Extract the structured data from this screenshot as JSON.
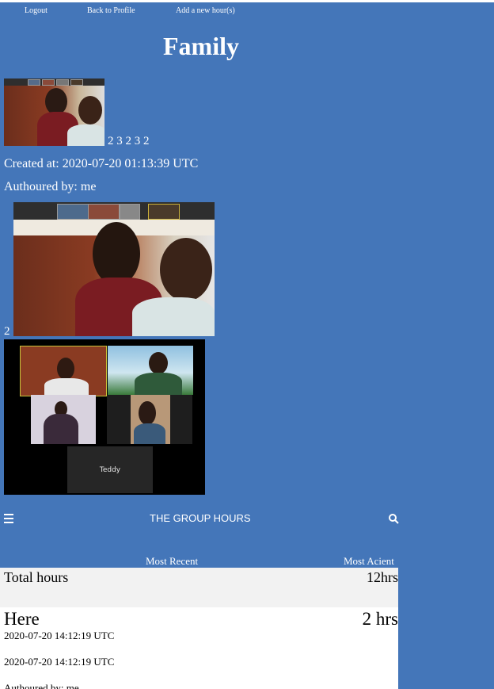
{
  "nav": {
    "logout": "Logout",
    "back": "Back to Profile",
    "add": "Add a new hour(s)"
  },
  "post": {
    "title": "Family",
    "numbers": "2 3 2 3 2",
    "created": "Created at: 2020-07-20 01:13:39 UTC",
    "author": "Authoured by: me",
    "count": "2",
    "grid_tile_label": "Teddy"
  },
  "group": {
    "title": "THE GROUP HOURS",
    "menu_icon": "hamburger-menu-icon",
    "search_icon": "search-icon",
    "sort_recent": "Most Recent",
    "sort_ancient": "Most Acient",
    "total_label": "Total hours",
    "total_value": "12hrs"
  },
  "entry": {
    "name": "Here",
    "hours": "2 hrs",
    "date1": "2020-07-20 14:12:19 UTC",
    "date2": "2020-07-20 14:12:19 UTC",
    "author": "Authoured by: me"
  },
  "colors": {
    "background": "#4476b9",
    "total_row": "#f2f2f2"
  }
}
